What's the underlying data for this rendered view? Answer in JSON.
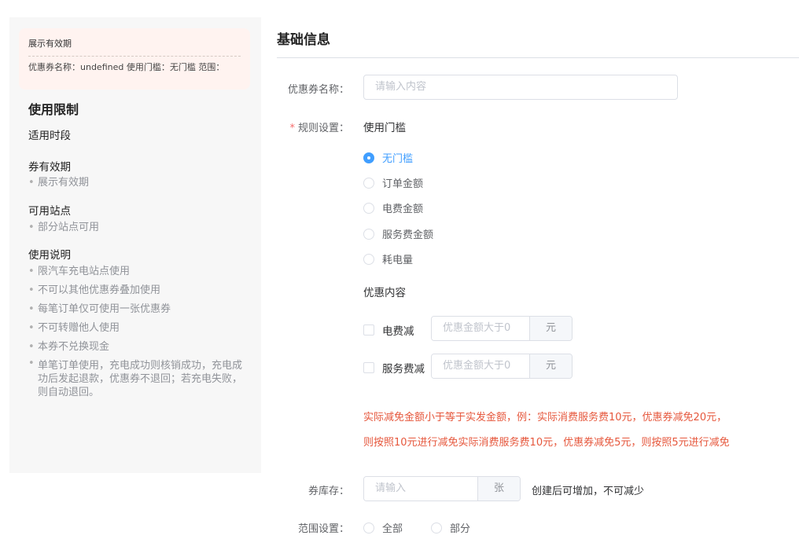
{
  "preview": {
    "card_title": "展示有效期",
    "card_summary": "优惠券名称：undefined 使用门槛：无门槛 范围：",
    "heading": "使用限制",
    "time_label": "适用时段",
    "validity_label": "券有效期",
    "validity_items": [
      "展示有效期"
    ],
    "station_label": "可用站点",
    "station_items": [
      "部分站点可用"
    ],
    "instructions_label": "使用说明",
    "instructions_items": [
      "限汽车充电站点使用",
      "不可以其他优惠券叠加使用",
      "每笔订单仅可使用一张优惠券",
      "不可转赠他人使用",
      "本券不兑换现金",
      "单笔订单使用，充电成功则核销成功，充电成功后发起退款，优惠券不退回；若充电失败，则自动退回。"
    ]
  },
  "form": {
    "section_title": "基础信息",
    "name_label": "优惠券名称：",
    "name_placeholder": "请输入内容",
    "rule_required_mark": "*",
    "rule_label": "规则设置：",
    "threshold_title": "使用门槛",
    "threshold_options": [
      "无门槛",
      "订单金额",
      "电费金额",
      "服务费金额",
      "耗电量"
    ],
    "threshold_selected": "无门槛",
    "discount_title": "优惠内容",
    "discount_rows": [
      {
        "label": "电费减",
        "placeholder": "优惠金额大于0",
        "unit": "元"
      },
      {
        "label": "服务费减",
        "placeholder": "优惠金额大于0",
        "unit": "元"
      }
    ],
    "note_line1": "实际减免金额小于等于实发金额，例：实际消费服务费10元，优惠券减免20元，",
    "note_line2": "则按照10元进行减免实际消费服务费10元，优惠券减免5元，则按照5元进行减免",
    "stock_label": "券库存：",
    "stock_placeholder": "请输入",
    "stock_unit": "张",
    "stock_hint": "创建后可增加，不可减少",
    "scope_label": "范围设置：",
    "scope_options": [
      "全部",
      "部分"
    ]
  },
  "colors": {
    "accent": "#409eff",
    "warning_text": "#e6573c",
    "required": "#f56c6c",
    "preview_bg": "#f7f7f7",
    "card_bg": "#fff3f0"
  }
}
